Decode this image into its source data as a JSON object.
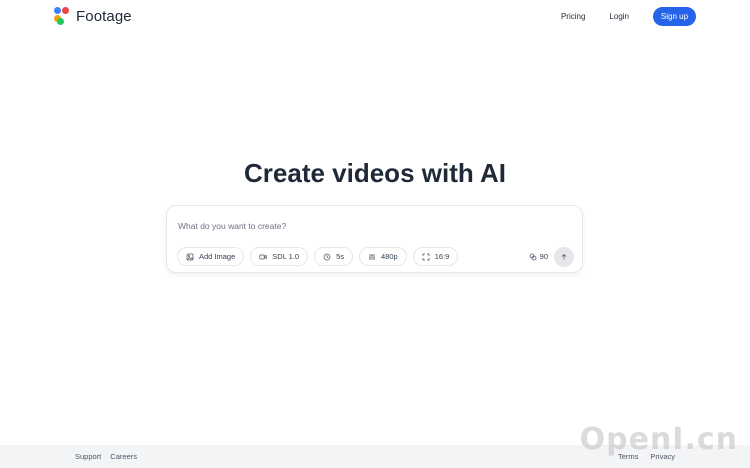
{
  "header": {
    "logo_text": "Footage",
    "nav": {
      "pricing": "Pricing",
      "login": "Login",
      "signup": "Sign up"
    }
  },
  "hero": {
    "title": "Create videos with AI",
    "prompt_placeholder": "What do you want to create?",
    "chips": {
      "add_image": "Add Image",
      "model": "SDL 1.0",
      "duration": "5s",
      "resolution": "480p",
      "aspect": "16:9"
    },
    "credits": "90"
  },
  "footer": {
    "support": "Support",
    "careers": "Careers",
    "terms": "Terms",
    "privacy": "Privacy"
  },
  "watermark": "OpenI.cn",
  "colors": {
    "accent": "#2563eb",
    "footer_bg": "#f3f4f6"
  }
}
